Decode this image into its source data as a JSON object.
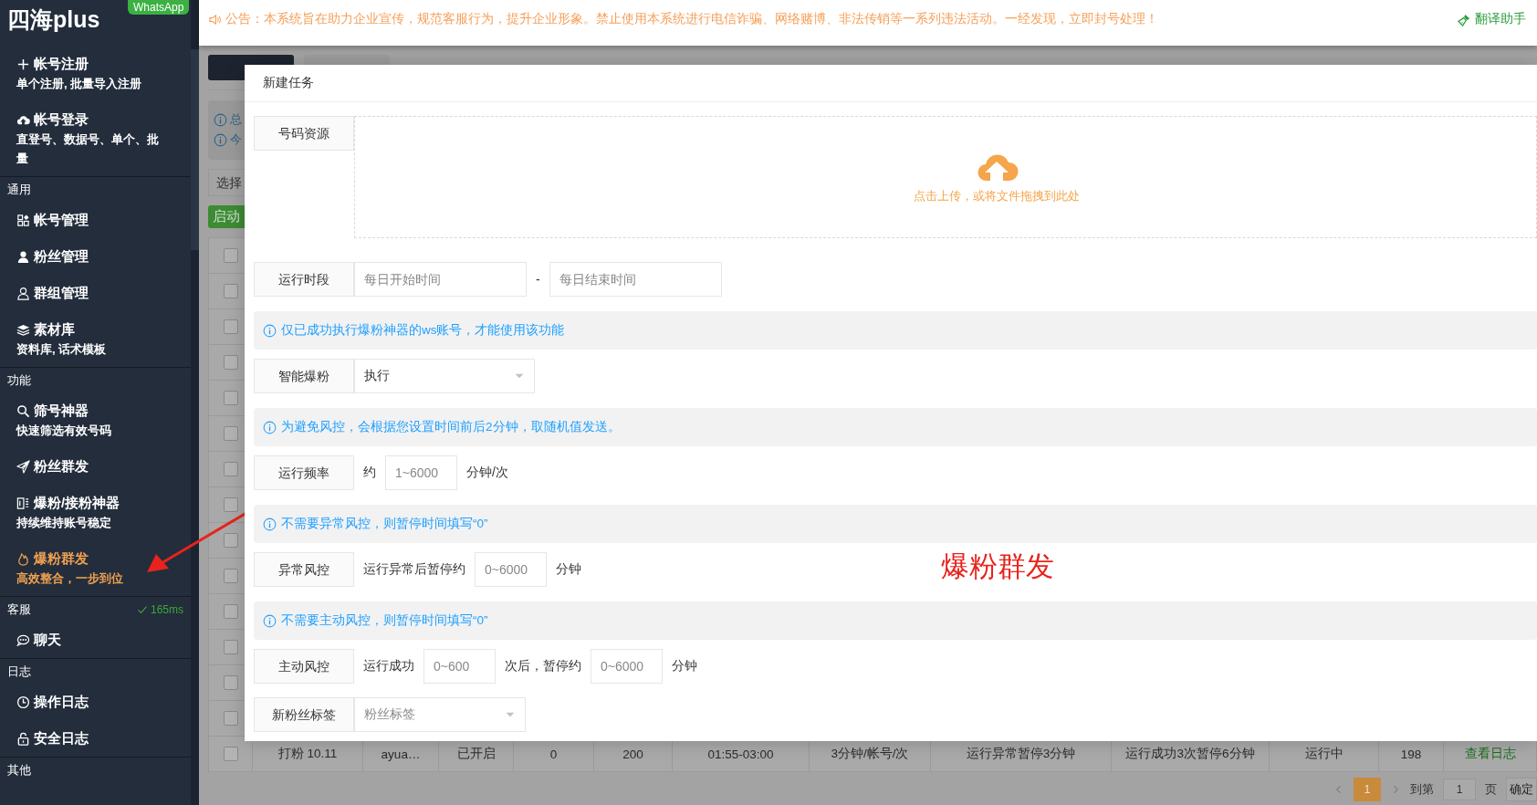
{
  "sidebar": {
    "logo": "四海plus",
    "badge": "WhatsApp",
    "sections": [
      {
        "items": [
          {
            "label": "帐号注册",
            "subtitle": "单个注册, 批量导入注册",
            "selected": false
          },
          {
            "label": "帐号登录",
            "subtitle": "直登号、数据号、单个、批量",
            "selected": false
          }
        ]
      },
      {
        "title": "通用",
        "items": [
          {
            "label": "帐号管理",
            "selected": false
          },
          {
            "label": "粉丝管理",
            "selected": false
          },
          {
            "label": "群组管理",
            "selected": false
          },
          {
            "label": "素材库",
            "subtitle": "资料库, 话术模板",
            "selected": false
          }
        ]
      },
      {
        "title": "功能",
        "items": [
          {
            "label": "筛号神器",
            "subtitle": "快速筛选有效号码",
            "selected": false
          },
          {
            "label": "粉丝群发",
            "selected": false
          },
          {
            "label": "爆粉/接粉神器",
            "subtitle": "持续维持账号稳定",
            "selected": false
          },
          {
            "label": "爆粉群发",
            "subtitle": "高效整合，一步到位",
            "selected": true
          }
        ]
      },
      {
        "title": "客服",
        "status": "165ms",
        "items": [
          {
            "label": "聊天",
            "selected": false
          }
        ]
      },
      {
        "title": "日志",
        "items": [
          {
            "label": "操作日志",
            "selected": false
          },
          {
            "label": "安全日志",
            "selected": false
          }
        ]
      },
      {
        "title": "其他"
      }
    ]
  },
  "topbar": {
    "notice": "公告：本系统旨在助力企业宣传，规范客服行为，提升企业形象。禁止使用本系统进行电信诈骗、网络赌博、非法传销等一系列违法活动。一经发现，立即封号处理！",
    "link": "翻译助手"
  },
  "background": {
    "tabs": [
      {
        "selected": true
      },
      {
        "selected": false
      }
    ],
    "info": [
      "总",
      "今"
    ],
    "select": "选择",
    "start_button": "启动",
    "table": {
      "rows": [
        {
          "checked": false
        },
        {
          "checked": false
        },
        {
          "checked": false
        },
        {
          "checked": false
        },
        {
          "checked": false
        },
        {
          "checked": false
        },
        {
          "checked": false
        },
        {
          "checked": false
        },
        {
          "checked": false
        },
        {
          "checked": false
        },
        {
          "checked": false
        },
        {
          "checked": false
        },
        {
          "checked": false
        },
        {
          "checked": false
        },
        {
          "checked": false,
          "cells": [
            "打粉 10.11",
            "ayua…",
            "已开启",
            "0",
            "200",
            "01:55-03:00",
            "3分钟/帐号/次",
            "运行异常暂停3分钟",
            "运行成功3次暂停6分钟",
            "运行中",
            "198"
          ],
          "action": "查看日志"
        }
      ]
    },
    "pagination": {
      "pages": [
        {
          "label": "1",
          "selected": true
        }
      ],
      "goto_label": "到第",
      "goto_value": "1",
      "page_unit": "页",
      "confirm": "确定"
    }
  },
  "modal": {
    "title": "新建任务",
    "rows": [
      {
        "kind": "upload",
        "label": "号码资源",
        "hint": "点击上传，或将文件拖拽到此处"
      },
      {
        "kind": "fields",
        "label": "运行时段",
        "parts": [
          {
            "kind": "input",
            "placeholder": "每日开始时间"
          },
          {
            "kind": "text",
            "text": "-"
          },
          {
            "kind": "input",
            "placeholder": "每日结束时间"
          }
        ]
      },
      {
        "kind": "notice",
        "text": "仅已成功执行爆粉神器的ws账号，才能使用该功能"
      },
      {
        "kind": "fields",
        "label": "智能爆粉",
        "parts": [
          {
            "kind": "select",
            "value": "执行"
          }
        ]
      },
      {
        "kind": "notice",
        "text": "为避免风控，会根据您设置时间前后2分钟，取随机值发送。"
      },
      {
        "kind": "fields",
        "label": "运行频率",
        "parts": [
          {
            "kind": "text",
            "text": "约"
          },
          {
            "kind": "input",
            "placeholder": "1~6000"
          },
          {
            "kind": "text",
            "text": "分钟/次"
          }
        ]
      },
      {
        "kind": "notice",
        "text": "不需要异常风控，则暂停时间填写“0”"
      },
      {
        "kind": "fields",
        "label": "异常风控",
        "parts": [
          {
            "kind": "text",
            "text": "运行异常后暂停约"
          },
          {
            "kind": "input",
            "placeholder": "0~6000"
          },
          {
            "kind": "text",
            "text": "分钟"
          }
        ]
      },
      {
        "kind": "notice",
        "text": "不需要主动风控，则暂停时间填写“0”"
      },
      {
        "kind": "fields",
        "label": "主动风控",
        "parts": [
          {
            "kind": "text",
            "text": "运行成功"
          },
          {
            "kind": "input",
            "placeholder": "0~600"
          },
          {
            "kind": "text",
            "text": "次后，暂停约"
          },
          {
            "kind": "input",
            "placeholder": "0~6000"
          },
          {
            "kind": "text",
            "text": "分钟"
          }
        ]
      },
      {
        "kind": "fields",
        "label": "新粉丝标签",
        "parts": [
          {
            "kind": "select",
            "placeholder": "粉丝标签"
          }
        ]
      }
    ],
    "annotation": "爆粉群发"
  }
}
